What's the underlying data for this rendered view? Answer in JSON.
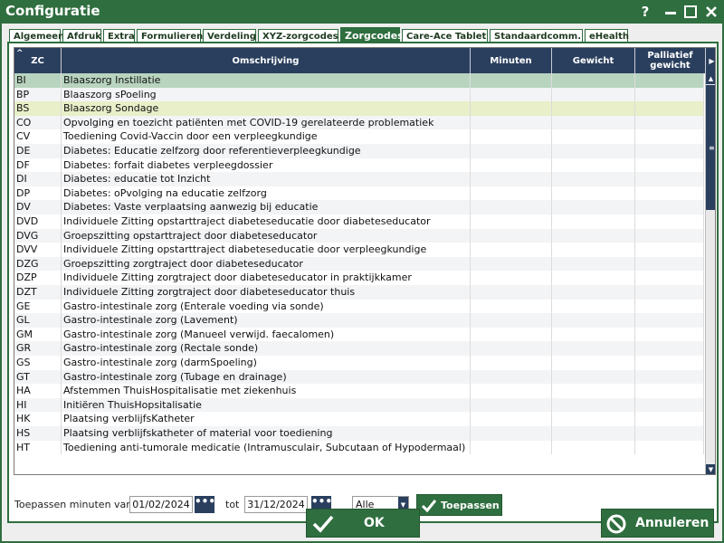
{
  "window": {
    "title": "Configuratie",
    "help": "?"
  },
  "tabs": [
    {
      "label": "Algemeen"
    },
    {
      "label": "Afdruk"
    },
    {
      "label": "Extra"
    },
    {
      "label": "Formulieren"
    },
    {
      "label": "Verdeling"
    },
    {
      "label": "XYZ-zorgcodes"
    },
    {
      "label": "Zorgcodes",
      "active": true
    },
    {
      "label": "Care-Ace Tablet"
    },
    {
      "label": "Standaardcomm."
    },
    {
      "label": "eHealth"
    }
  ],
  "table": {
    "columns": {
      "code": "ZC",
      "description": "Omschrijving",
      "minutes": "Minuten",
      "weight": "Gewicht",
      "palliative": "Palliatief gewicht"
    },
    "rows": [
      {
        "code": "BI",
        "desc": "Blaaszorg Instillatie"
      },
      {
        "code": "BP",
        "desc": "Blaaszorg sPoeling"
      },
      {
        "code": "BS",
        "desc": "Blaaszorg Sondage"
      },
      {
        "code": "CO",
        "desc": "Opvolging en toezicht patiënten met COVID-19 gerelateerde problematiek"
      },
      {
        "code": "CV",
        "desc": "Toediening Covid-Vaccin door een verpleegkundige"
      },
      {
        "code": "DE",
        "desc": "Diabetes: Educatie zelfzorg door referentieverpleegkundige"
      },
      {
        "code": "DF",
        "desc": "Diabetes: forfait diabetes verpleegdossier"
      },
      {
        "code": "DI",
        "desc": "Diabetes: educatie tot Inzicht"
      },
      {
        "code": "DP",
        "desc": "Diabetes: oPvolging na educatie zelfzorg"
      },
      {
        "code": "DV",
        "desc": "Diabetes: Vaste verplaatsing aanwezig bij educatie"
      },
      {
        "code": "DVD",
        "desc": "Individuele Zitting opstarttraject diabeteseducatie door diabeteseducator"
      },
      {
        "code": "DVG",
        "desc": "Groepszitting opstarttraject door diabeteseducator"
      },
      {
        "code": "DVV",
        "desc": "Individuele Zitting opstarttraject diabeteseducatie door verpleegkundige"
      },
      {
        "code": "DZG",
        "desc": "Groepszitting zorgtraject door diabeteseducator"
      },
      {
        "code": "DZP",
        "desc": "Individuele Zitting zorgtraject door diabeteseducator in praktijkkamer"
      },
      {
        "code": "DZT",
        "desc": "Individuele Zitting zorgtraject door diabeteseducator thuis"
      },
      {
        "code": "GE",
        "desc": "Gastro-intestinale zorg (Enterale voeding via sonde)"
      },
      {
        "code": "GL",
        "desc": "Gastro-intestinale zorg (Lavement)"
      },
      {
        "code": "GM",
        "desc": "Gastro-intestinale zorg (Manueel verwijd. faecalomen)"
      },
      {
        "code": "GR",
        "desc": "Gastro-intestinale zorg (Rectale sonde)"
      },
      {
        "code": "GS",
        "desc": "Gastro-intestinale zorg (darmSpoeling)"
      },
      {
        "code": "GT",
        "desc": "Gastro-intestinale zorg (Tubage en drainage)"
      },
      {
        "code": "HA",
        "desc": "Afstemmen ThuisHospitalisatie met ziekenhuis"
      },
      {
        "code": "HI",
        "desc": "Initiëren ThuisHopsitalisatie"
      },
      {
        "code": "HK",
        "desc": "Plaatsing verblijfsKatheter"
      },
      {
        "code": "HS",
        "desc": "Plaatsing verblijfskatheter of material voor toediening"
      },
      {
        "code": "HT",
        "desc": "Toediening anti-tumorale medicatie (Intramusculair, Subcutaan of Hypodermaal)"
      }
    ]
  },
  "filter": {
    "label_from": "Toepassen minuten van",
    "date_from": "01/02/2024",
    "label_to": "tot",
    "date_to": "31/12/2024",
    "scope": "Alle",
    "apply_label": "Toepassen"
  },
  "footer": {
    "ok_label": "OK",
    "cancel_label": "Annuleren"
  },
  "colors": {
    "brand_green": "#2f6e3f",
    "header_navy": "#2a3f5e",
    "selected_row": "#b8d4bf",
    "highlight_row": "#e8efc9"
  }
}
